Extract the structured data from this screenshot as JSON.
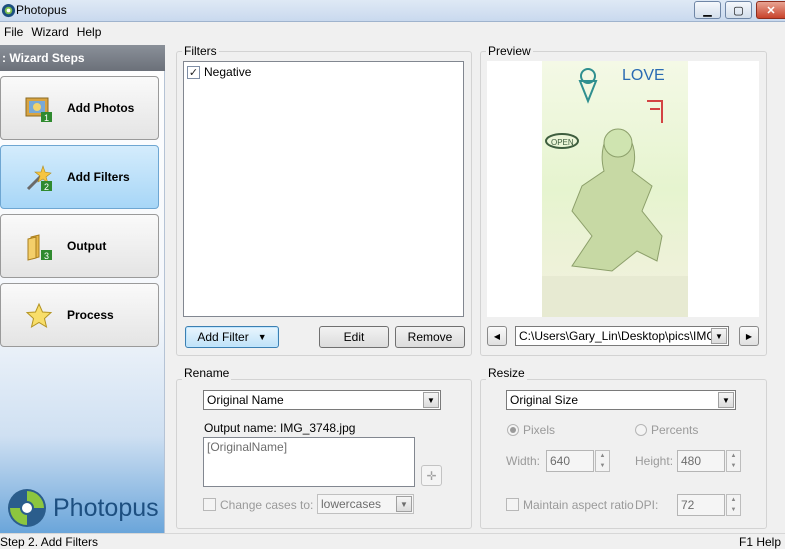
{
  "window": {
    "title": "Photopus",
    "minimize_icon": "minimize-icon",
    "maximize_icon": "maximize-icon",
    "close_icon": "close-icon"
  },
  "menu": [
    "File",
    "Wizard",
    "Help"
  ],
  "sidebar": {
    "header": "Wizard Steps",
    "steps": [
      {
        "label": "Add Photos",
        "number": "1",
        "icon": "photos-icon",
        "active": false
      },
      {
        "label": "Add Filters",
        "number": "2",
        "icon": "magic-wand-icon",
        "active": true
      },
      {
        "label": "Output",
        "number": "3",
        "icon": "folder-icon",
        "active": false
      },
      {
        "label": "Process",
        "number": "",
        "icon": "star-icon",
        "active": false
      }
    ],
    "brand": "Photopus"
  },
  "filters": {
    "group_label": "Filters",
    "items": [
      {
        "label": "Negative",
        "checked": true
      }
    ],
    "add_filter_label": "Add Filter",
    "edit_label": "Edit",
    "remove_label": "Remove"
  },
  "preview": {
    "group_label": "Preview",
    "image_texts": [
      "LOVE",
      "OPEN"
    ],
    "path": "C:\\Users\\Gary_Lin\\Desktop\\pics\\IMG_",
    "prev_icon": "left-arrow-icon",
    "next_icon": "right-arrow-icon"
  },
  "rename": {
    "group_label": "Rename",
    "mode": "Original Name",
    "output_name_label": "Output name: IMG_3748.jpg",
    "pattern": "[OriginalName]",
    "change_cases_label": "Change cases to:",
    "change_cases_checked": false,
    "case_value": "lowercases"
  },
  "resize": {
    "group_label": "Resize",
    "mode": "Original Size",
    "pixels_label": "Pixels",
    "percents_label": "Percents",
    "pixels_selected": true,
    "width_label": "Width:",
    "width_value": "640",
    "height_label": "Height:",
    "height_value": "480",
    "maintain_label": "Maintain aspect ratio",
    "dpi_label": "DPI:",
    "dpi_value": "72"
  },
  "status": {
    "left": "Step 2. Add Filters",
    "right": "F1 Help"
  },
  "colors": {
    "active_step": "#a7d6f7",
    "brand": "#1d4f80",
    "title_bar": "#c9d9ee"
  }
}
